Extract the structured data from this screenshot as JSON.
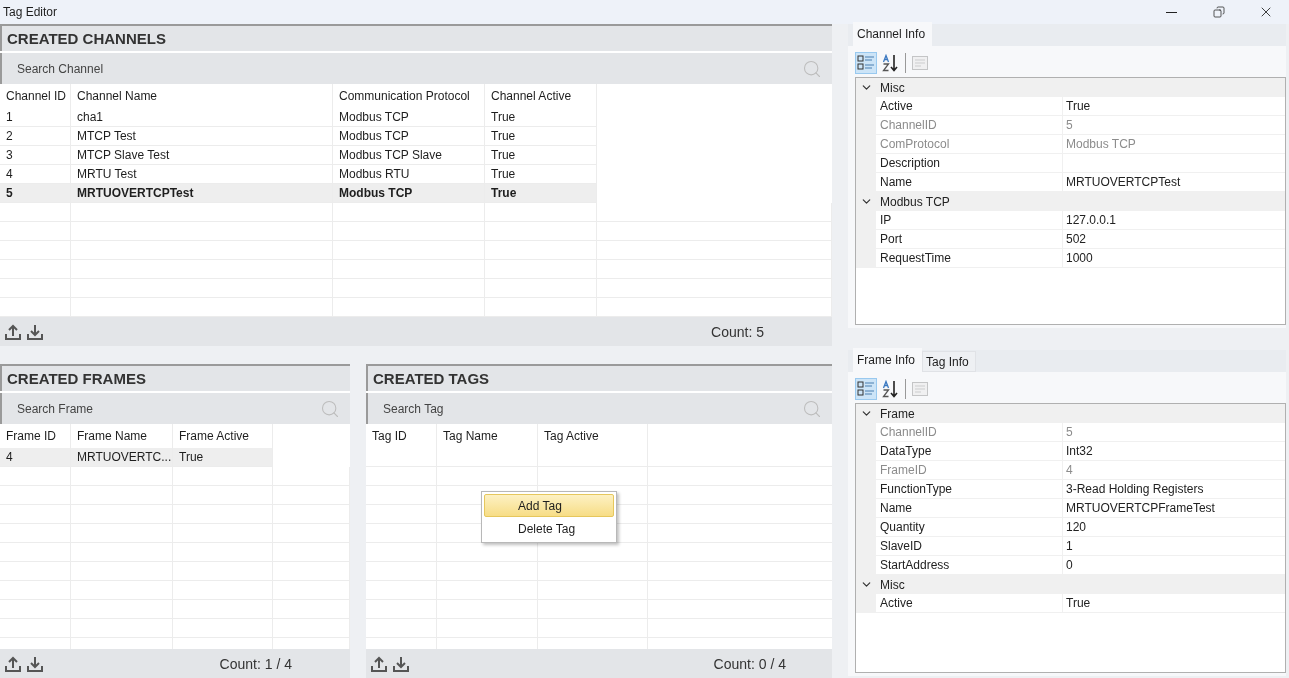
{
  "window": {
    "title": "Tag Editor"
  },
  "channels": {
    "title": "CREATED CHANNELS",
    "search": {
      "placeholder": "Search Channel"
    },
    "columns": [
      "Channel ID",
      "Channel Name",
      "Communication Protocol",
      "Channel Active"
    ],
    "rows": [
      {
        "cells": [
          "1",
          "cha1",
          "Modbus TCP",
          "True"
        ],
        "selected": false,
        "bold": false
      },
      {
        "cells": [
          "2",
          "MTCP Test",
          "Modbus TCP",
          "True"
        ],
        "selected": false,
        "bold": false
      },
      {
        "cells": [
          "3",
          "MTCP Slave Test",
          "Modbus TCP Slave",
          "True"
        ],
        "selected": false,
        "bold": false
      },
      {
        "cells": [
          "4",
          "MRTU Test",
          "Modbus RTU",
          "True"
        ],
        "selected": false,
        "bold": false
      },
      {
        "cells": [
          "5",
          "MRTUOVERTCPTest",
          "Modbus TCP",
          "True"
        ],
        "selected": true,
        "bold": true
      }
    ],
    "count": "Count: 5"
  },
  "frames": {
    "title": "CREATED FRAMES",
    "search": {
      "placeholder": "Search Frame"
    },
    "columns": [
      "Frame ID",
      "Frame Name",
      "Frame Active"
    ],
    "rows": [
      {
        "cells": [
          "4",
          "MRTUOVERTC...",
          "True"
        ],
        "selected": true,
        "bold": false
      }
    ],
    "count": "Count: 1 / 4"
  },
  "tags": {
    "title": "CREATED TAGS",
    "search": {
      "placeholder": "Search Tag"
    },
    "columns": [
      "Tag ID",
      "Tag Name",
      "Tag Active"
    ],
    "count": "Count: 0 / 4",
    "context_menu": {
      "items": [
        {
          "label": "Add Tag",
          "highlighted": true
        },
        {
          "label": "Delete Tag",
          "highlighted": false
        }
      ]
    }
  },
  "channel_info": {
    "tabs": [
      {
        "label": "Channel Info",
        "selected": true
      }
    ],
    "toolbar": [
      {
        "kind": "categorized",
        "selected": true,
        "disabled": false
      },
      {
        "kind": "alphabetical",
        "selected": false,
        "disabled": false
      },
      {
        "kind": "pages",
        "selected": false,
        "disabled": true
      }
    ],
    "categories": [
      {
        "name": "Misc",
        "expanded": true,
        "properties": [
          {
            "name": "Active",
            "value": "True",
            "readonly": false
          },
          {
            "name": "ChannelID",
            "value": "5",
            "readonly": true
          },
          {
            "name": "ComProtocol",
            "value": "Modbus TCP",
            "readonly": true
          },
          {
            "name": "Description",
            "readonly": false
          },
          {
            "name": "Name",
            "value": "MRTUOVERTCPTest",
            "readonly": false
          }
        ]
      },
      {
        "name": "Modbus TCP",
        "expanded": true,
        "properties": [
          {
            "name": "IP",
            "value": "127.0.0.1",
            "readonly": false
          },
          {
            "name": "Port",
            "value": "502",
            "readonly": false
          },
          {
            "name": "RequestTime",
            "value": "1000",
            "readonly": false
          }
        ]
      }
    ]
  },
  "frame_info": {
    "tabs": [
      {
        "label": "Frame Info",
        "selected": true
      },
      {
        "label": "Tag Info",
        "selected": false
      }
    ],
    "toolbar": [
      {
        "kind": "categorized",
        "selected": true,
        "disabled": false
      },
      {
        "kind": "alphabetical",
        "selected": false,
        "disabled": false
      },
      {
        "kind": "pages",
        "selected": false,
        "disabled": true
      }
    ],
    "categories": [
      {
        "name": "Frame",
        "expanded": true,
        "properties": [
          {
            "name": "ChannelID",
            "value": "5",
            "readonly": true
          },
          {
            "name": "DataType",
            "value": "Int32",
            "readonly": false
          },
          {
            "name": "FrameID",
            "value": "4",
            "readonly": true
          },
          {
            "name": "FunctionType",
            "value": "3-Read Holding Registers",
            "readonly": false
          },
          {
            "name": "Name",
            "value": "MRTUOVERTCPFrameTest",
            "readonly": false
          },
          {
            "name": "Quantity",
            "value": "120",
            "readonly": false
          },
          {
            "name": "SlaveID",
            "value": "1",
            "readonly": false
          },
          {
            "name": "StartAddress",
            "value": "0",
            "readonly": false
          }
        ]
      },
      {
        "name": "Misc",
        "expanded": true,
        "properties": [
          {
            "name": "Active",
            "value": "True",
            "readonly": false
          }
        ]
      }
    ]
  }
}
